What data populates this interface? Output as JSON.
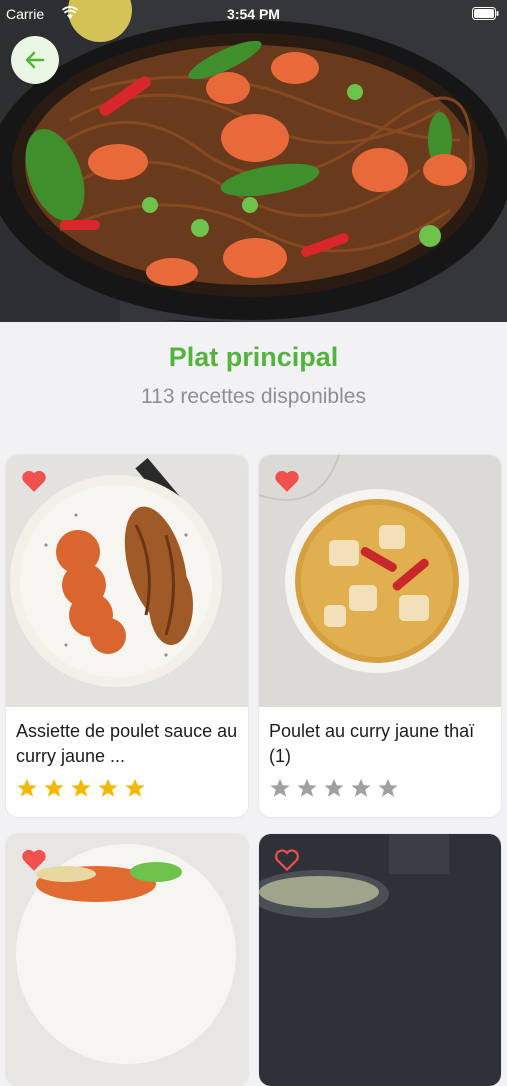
{
  "status_bar": {
    "carrier": "Carrie",
    "time": "3:54 PM"
  },
  "category": {
    "title": "Plat principal",
    "count_text": "113 recettes disponibles"
  },
  "recipes": [
    {
      "name": "Assiette de poulet sauce au curry jaune ...",
      "rating": 5,
      "favorite": true
    },
    {
      "name": "Poulet au curry jaune thaï (1)",
      "rating": 0,
      "favorite": true
    },
    {
      "name": "",
      "rating": 0,
      "favorite": true
    },
    {
      "name": "",
      "rating": 0,
      "favorite": false
    }
  ],
  "colors": {
    "accent": "#52b43c",
    "star_on": "#f5b800",
    "star_off": "#a0a0a3",
    "heart": "#f0504e"
  },
  "icons": {
    "back": "arrow-left-icon",
    "favorite": "heart-icon",
    "rating": "star-icon"
  }
}
